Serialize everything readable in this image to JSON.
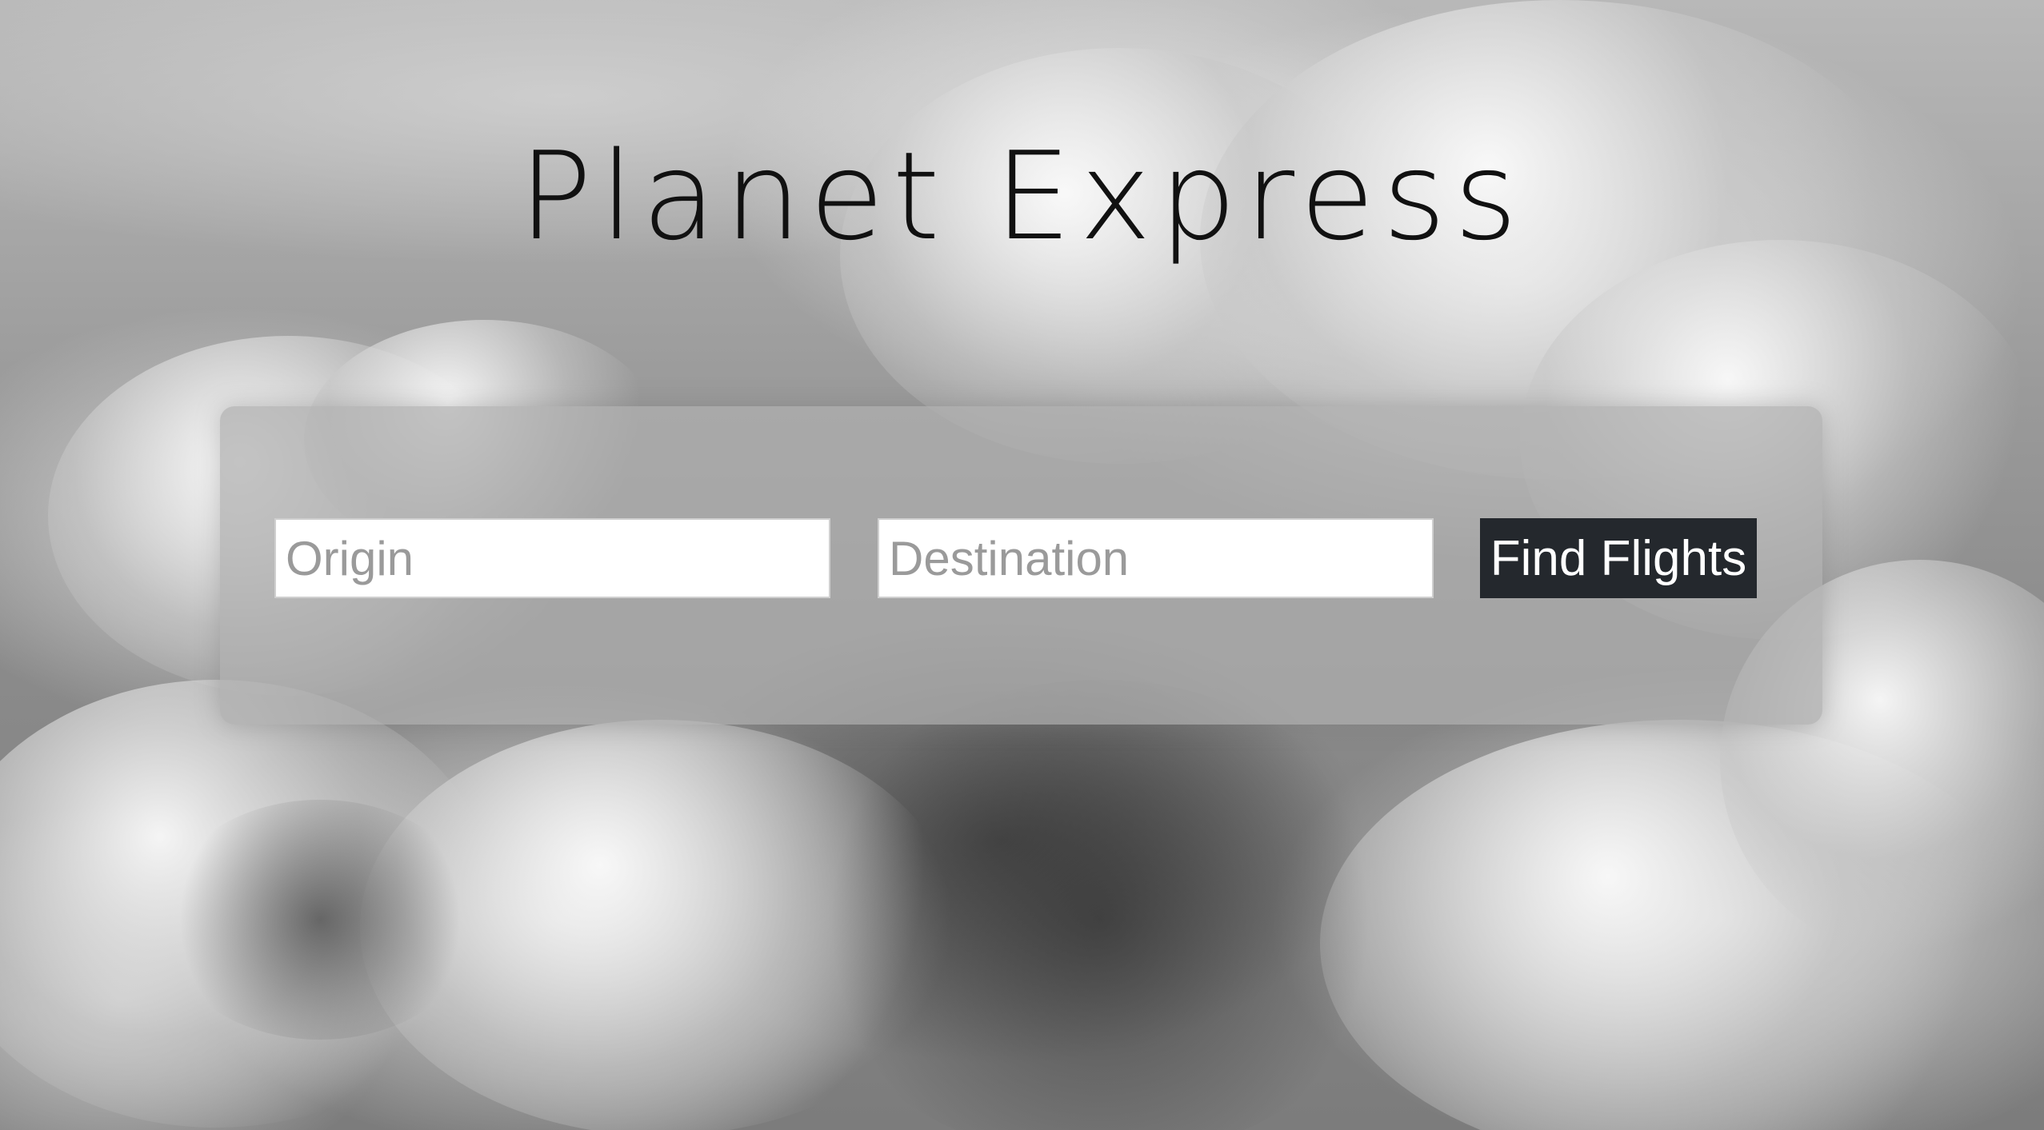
{
  "app": {
    "title": "Planet Express"
  },
  "search": {
    "origin_placeholder": "Origin",
    "origin_value": "",
    "destination_placeholder": "Destination",
    "destination_value": "",
    "submit_label": "Find Flights"
  },
  "colors": {
    "button_background": "#24282d",
    "button_text": "#ffffff",
    "title_text": "#111111",
    "panel_background": "rgba(175,175,175,0.72)"
  }
}
